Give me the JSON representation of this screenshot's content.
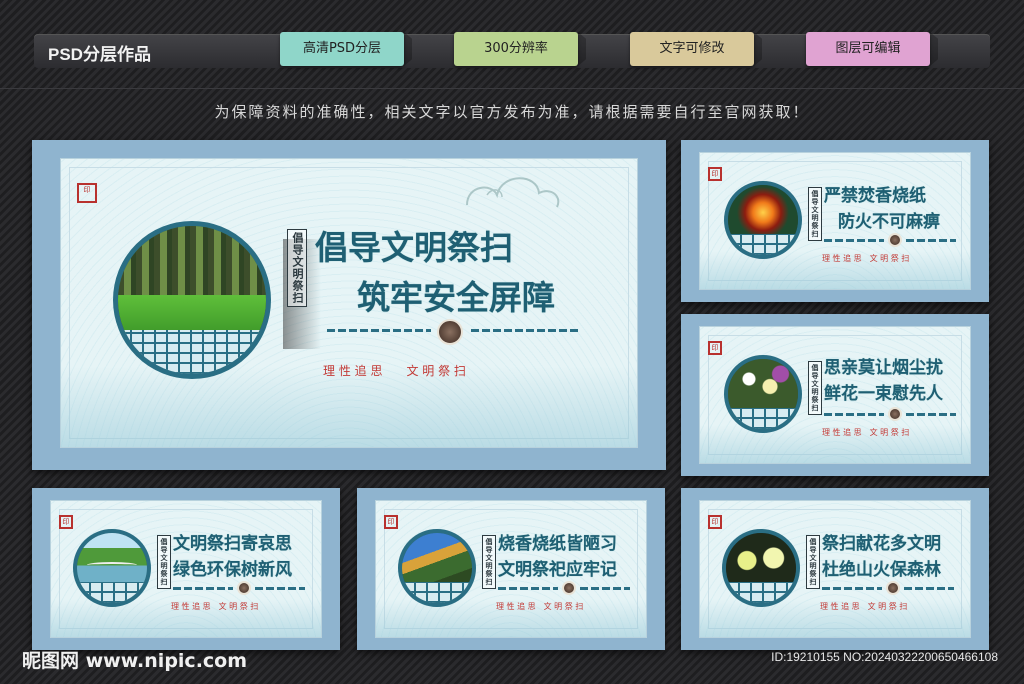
{
  "header": {
    "title": "PSD分层作品",
    "tags": [
      "高清PSD分层",
      "300分辨率",
      "文字可修改",
      "图层可编辑"
    ]
  },
  "notice": "为保障资料的准确性，相关文字以官方发布为准，请根据需要自行至官网获取！",
  "boards": [
    {
      "vertical_label": "倡导文明祭扫",
      "line1": "倡导文明祭扫",
      "line2": "筑牢安全屏障",
      "tagline": "理 性 追 思　　文 明 祭 扫",
      "photo": "forest"
    },
    {
      "vertical_label": "倡导文明祭扫",
      "line1": "严禁焚香烧纸",
      "line2": "防火不可麻痹",
      "tagline": "理 性 追 思　文 明 祭 扫",
      "photo": "fire"
    },
    {
      "vertical_label": "倡导文明祭扫",
      "line1": "思亲莫让烟尘扰",
      "line2": "鲜花一束慰先人",
      "tagline": "理 性 追 思　文 明 祭 扫",
      "photo": "flowers"
    },
    {
      "vertical_label": "倡导文明祭扫",
      "line1": "文明祭扫寄哀思",
      "line2": "绿色环保树新风",
      "tagline": "理 性 追 思　文 明 祭 扫",
      "photo": "bridge"
    },
    {
      "vertical_label": "倡导文明祭扫",
      "line1": "烧香烧纸皆陋习",
      "line2": "文明祭祀应牢记",
      "tagline": "理 性 追 思　文 明 祭 扫",
      "photo": "eaves"
    },
    {
      "vertical_label": "倡导文明祭扫",
      "line1": "祭扫献花多文明",
      "line2": "杜绝山火保森林",
      "tagline": "理 性 追 思　文 明 祭 扫",
      "photo": "chrysanthemum"
    }
  ],
  "footer": {
    "site": "昵图网 www.nipic.com",
    "id": "ID:19210155 NO:20240322200650466108"
  }
}
